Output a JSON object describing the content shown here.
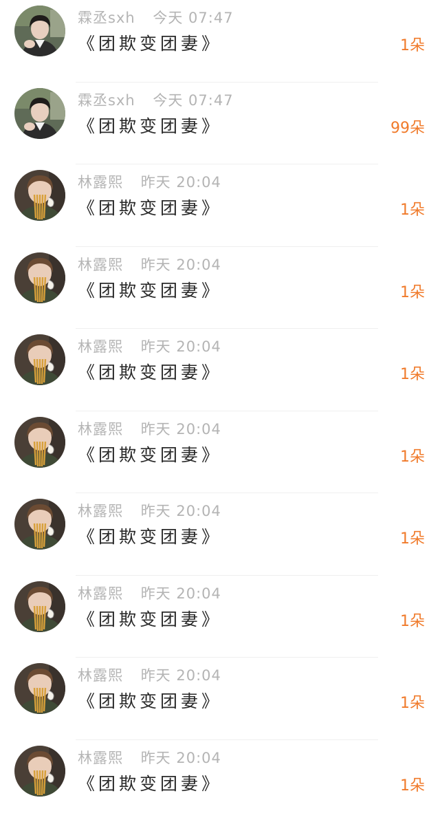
{
  "list": [
    {
      "avatar": "avatar-young-man",
      "name": "霖丞sxh",
      "time": "今天 07:47",
      "title": "《团欺变团妻》",
      "gift": "1朵"
    },
    {
      "avatar": "avatar-young-man",
      "name": "霖丞sxh",
      "time": "今天 07:47",
      "title": "《团欺变团妻》",
      "gift": "99朵"
    },
    {
      "avatar": "avatar-girl-noodles",
      "name": "林露熙",
      "time": "昨天 20:04",
      "title": "《团欺变团妻》",
      "gift": "1朵"
    },
    {
      "avatar": "avatar-girl-noodles",
      "name": "林露熙",
      "time": "昨天 20:04",
      "title": "《团欺变团妻》",
      "gift": "1朵"
    },
    {
      "avatar": "avatar-girl-noodles",
      "name": "林露熙",
      "time": "昨天 20:04",
      "title": "《团欺变团妻》",
      "gift": "1朵"
    },
    {
      "avatar": "avatar-girl-noodles",
      "name": "林露熙",
      "time": "昨天 20:04",
      "title": "《团欺变团妻》",
      "gift": "1朵"
    },
    {
      "avatar": "avatar-girl-noodles",
      "name": "林露熙",
      "time": "昨天 20:04",
      "title": "《团欺变团妻》",
      "gift": "1朵"
    },
    {
      "avatar": "avatar-girl-noodles",
      "name": "林露熙",
      "time": "昨天 20:04",
      "title": "《团欺变团妻》",
      "gift": "1朵"
    },
    {
      "avatar": "avatar-girl-noodles",
      "name": "林露熙",
      "time": "昨天 20:04",
      "title": "《团欺变团妻》",
      "gift": "1朵"
    },
    {
      "avatar": "avatar-girl-noodles",
      "name": "林露熙",
      "time": "昨天 20:04",
      "title": "《团欺变团妻》",
      "gift": "1朵"
    }
  ],
  "colors": {
    "meta_text": "#b4b4b4",
    "title_text": "#2a2a2a",
    "gift_text": "#f07a2a",
    "divider": "#efefef"
  }
}
